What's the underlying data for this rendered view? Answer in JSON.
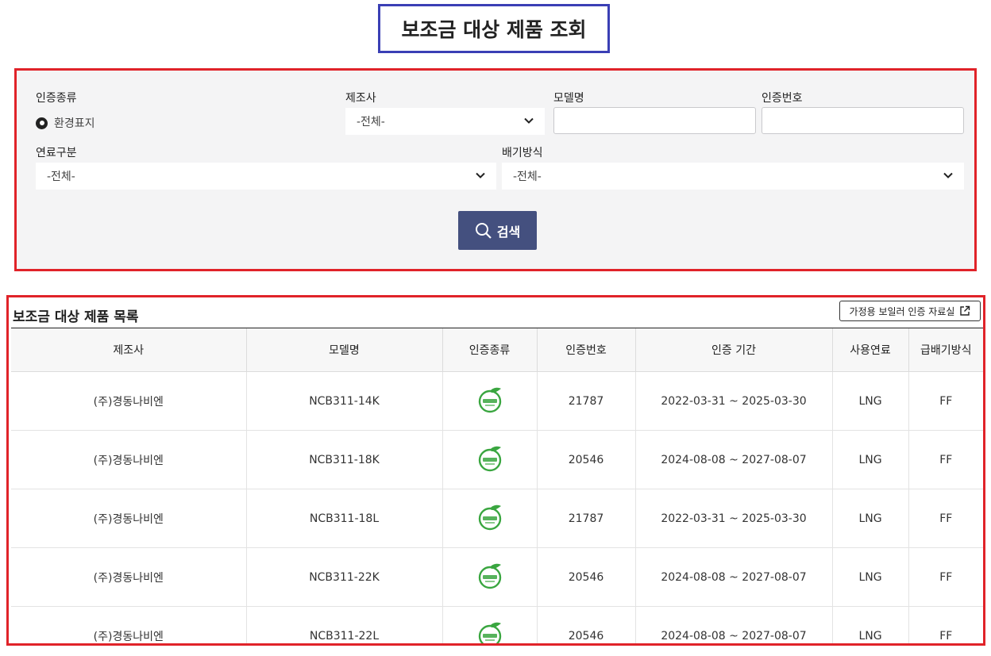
{
  "page": {
    "title": "보조금 대상 제품 조회"
  },
  "filters": {
    "cert_type_label": "인증종류",
    "cert_type_option": "환경표지",
    "maker_label": "제조사",
    "maker_value": "-전체-",
    "model_label": "모델명",
    "model_value": "",
    "cert_no_label": "인증번호",
    "cert_no_value": "",
    "fuel_label": "연료구분",
    "fuel_value": "-전체-",
    "exhaust_label": "배기방식",
    "exhaust_value": "-전체-",
    "search_button": "검색"
  },
  "list": {
    "title": "보조금 대상 제품 목록",
    "external_link": "가정용 보일러 인증 자료실",
    "columns": [
      "제조사",
      "모델명",
      "인증종류",
      "인증번호",
      "인증 기간",
      "사용연료",
      "급배기방식"
    ],
    "rows": [
      {
        "maker": "(주)경동나비엔",
        "model": "NCB311-14K",
        "cert_icon": "eco-label-icon",
        "cert_no": "21787",
        "period": "2022-03-31 ~ 2025-03-30",
        "fuel": "LNG",
        "exhaust": "FF"
      },
      {
        "maker": "(주)경동나비엔",
        "model": "NCB311-18K",
        "cert_icon": "eco-label-icon",
        "cert_no": "20546",
        "period": "2024-08-08 ~ 2027-08-07",
        "fuel": "LNG",
        "exhaust": "FF"
      },
      {
        "maker": "(주)경동나비엔",
        "model": "NCB311-18L",
        "cert_icon": "eco-label-icon",
        "cert_no": "21787",
        "period": "2022-03-31 ~ 2025-03-30",
        "fuel": "LNG",
        "exhaust": "FF"
      },
      {
        "maker": "(주)경동나비엔",
        "model": "NCB311-22K",
        "cert_icon": "eco-label-icon",
        "cert_no": "20546",
        "period": "2024-08-08 ~ 2027-08-07",
        "fuel": "LNG",
        "exhaust": "FF"
      },
      {
        "maker": "(주)경동나비엔",
        "model": "NCB311-22L",
        "cert_icon": "eco-label-icon",
        "cert_no": "20546",
        "period": "2024-08-08 ~ 2027-08-07",
        "fuel": "LNG",
        "exhaust": "FF"
      }
    ]
  },
  "colors": {
    "accent": "#44507f",
    "highlight_red": "#e02329",
    "title_border": "#3a3fb5",
    "eco_green": "#3aa640"
  }
}
